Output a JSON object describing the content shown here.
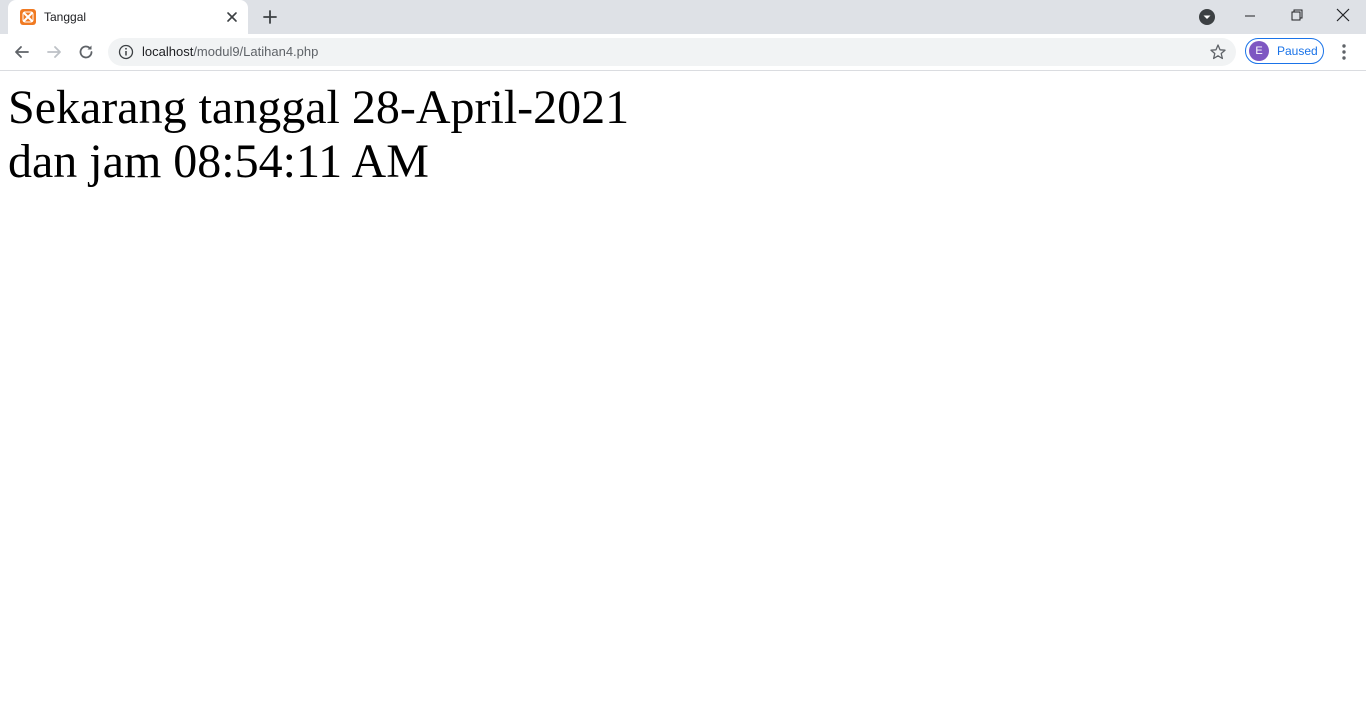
{
  "tab": {
    "title": "Tanggal"
  },
  "toolbar": {
    "url_host": "localhost",
    "url_path": "/modul9/Latihan4.php",
    "profile_initial": "E",
    "profile_status": "Paused"
  },
  "page": {
    "line1": "Sekarang tanggal 28-April-2021",
    "line2": "dan jam 08:54:11 AM"
  },
  "colors": {
    "tabstrip_bg": "#dee1e6",
    "omnibox_bg": "#f1f3f4",
    "favicon": "#f07a22",
    "avatar": "#7e57c2",
    "accent": "#1a73e8"
  },
  "icons": {
    "favicon": "xampp-icon",
    "tab_close": "close-icon",
    "new_tab": "plus-icon",
    "tab_search": "chevron-down-circle-icon",
    "back": "arrow-left-icon",
    "forward": "arrow-right-icon",
    "reload": "reload-icon",
    "site_info": "info-icon",
    "bookmark": "star-icon",
    "menu": "kebab-menu-icon"
  }
}
